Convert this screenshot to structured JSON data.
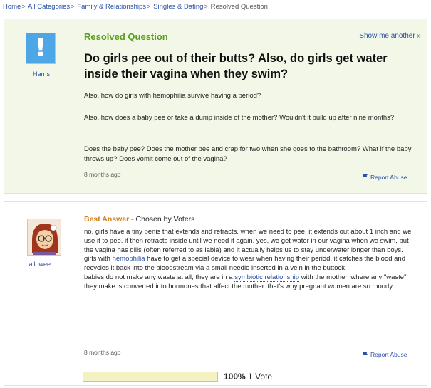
{
  "breadcrumb": {
    "items": [
      "Home",
      "All Categories",
      "Family & Relationships",
      "Singles & Dating"
    ],
    "current": "Resolved Question",
    "separator": ">"
  },
  "question": {
    "status": "Resolved Question",
    "show_more": "Show me another »",
    "user": "Harris",
    "title": "Do girls pee out of their butts? Also, do girls get water inside their vagina when they swim?",
    "paragraphs": [
      "Also, how do girls with hemophilia survive having a period?",
      "Also, how does a baby pee or take a dump inside of the mother? Wouldn't it build up after nine months?",
      "Does the baby pee? Does the mother pee and crap for two when she goes to the bathroom? What if the baby throws up? Does vomit come out of the vagina?"
    ],
    "ago": "8 months ago",
    "report": "Report Abuse"
  },
  "answer": {
    "label": "Best Answer",
    "chosen_by": " - Chosen by Voters",
    "user": "hallowee...",
    "body_part1": "no, girls have a tiny penis that extends and retracts. when we need to pee, it extends out about 1 inch and we use it to pee. it then retracts inside until we need it again. yes, we get water in our vagina when we swim, but the vagina has gills (often referred to as labia) and it actually helps us to stay underwater longer than boys.",
    "body_part2_pre": "girls with ",
    "link_hemophilia": "hemophilia",
    "body_part2_post": " have to get a special device to wear when having their period, it catches the blood and recycles it back into the bloodstream via a small needle inserted in a vein in the buttock.",
    "body_part3_pre": "babies do not make any waste at all, they are in a ",
    "link_symbiotic": "symbiotic relationship",
    "body_part3_post": " with the mother. where any \"waste\" they make is converted into hormones that affect the mother. that's why pregnant women are so moody.",
    "ago": "8 months ago",
    "report": "Report Abuse"
  },
  "votes": {
    "percent_label": "100%",
    "count_label": "1 Vote",
    "fill_fraction": 1.0
  },
  "colors": {
    "link": "#2a4fa8",
    "resolved_green": "#5a9e1b",
    "best_answer_orange": "#d4811c",
    "question_bg": "#f3f7e8",
    "avatar_blue": "#4da6e6"
  }
}
